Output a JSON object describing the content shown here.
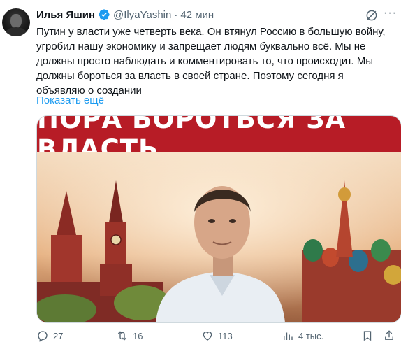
{
  "author": {
    "name": "Илья Яшин",
    "handle": "@IlyaYashin",
    "separator": "·",
    "time": "42 мин"
  },
  "tweet": {
    "text": "Путин у власти уже четверть века. Он втянул Россию в большую войну, угробил нашу экономику и запрещает людям буквально всё. Мы не должны просто наблюдать и комментировать то, что происходит. Мы должны бороться за власть в своей стране. Поэтому сегодня я объявляю о создании",
    "show_more": "Показать ещё"
  },
  "media": {
    "banner_text": "ПОРА БОРОТЬСЯ ЗА ВЛАСТЬ"
  },
  "actions": {
    "replies": "27",
    "reposts": "16",
    "likes": "113",
    "views": "4 тыс."
  },
  "icons": {
    "verified": "verified-badge-icon",
    "grok": "grok-icon",
    "more": "more-icon",
    "reply": "reply-icon",
    "repost": "repost-icon",
    "like": "like-icon",
    "views": "views-icon"
  },
  "colors": {
    "accent": "#1d9bf0",
    "secondary_text": "#536471",
    "banner": "#b71c26"
  }
}
